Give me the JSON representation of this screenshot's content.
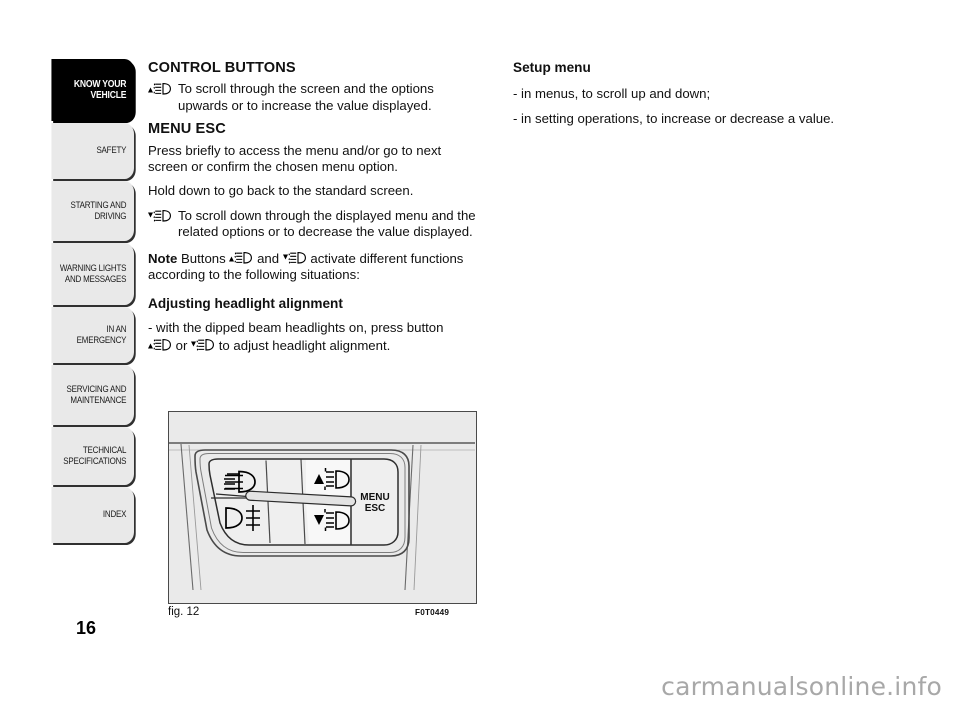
{
  "sidebar": {
    "tabs": [
      {
        "label": "KNOW YOUR\nVEHICLE",
        "active": true,
        "height": 62
      },
      {
        "label": "SAFETY",
        "active": false,
        "height": 56
      },
      {
        "label": "STARTING AND\nDRIVING",
        "active": false,
        "height": 60
      },
      {
        "label": "WARNING LIGHTS\nAND MESSAGES",
        "active": false,
        "height": 62
      },
      {
        "label": "IN AN EMERGENCY",
        "active": false,
        "height": 56
      },
      {
        "label": "SERVICING AND\nMAINTENANCE",
        "active": false,
        "height": 60
      },
      {
        "label": "TECHNICAL\nSPECIFICATIONS",
        "active": false,
        "height": 58
      },
      {
        "label": "INDEX",
        "active": false,
        "height": 56
      }
    ],
    "page_number": "16"
  },
  "left_column": {
    "heading": "CONTROL BUTTONS",
    "scroll_up_text": "To scroll through the screen and the options upwards or to increase the value displayed.",
    "menu_esc_heading": "MENU ESC",
    "menu_esc_p1": "Press briefly to access the menu and/or go to next screen or confirm the chosen menu option.",
    "menu_esc_p2": "Hold down to go back to the standard screen.",
    "scroll_down_text": "To scroll down through the displayed menu and the related options or to decrease the value displayed.",
    "note_label": "Note",
    "note_part1": "Buttons",
    "note_and": "and",
    "note_part2": "activate different functions according to the following situations:",
    "adjust_heading": "Adjusting headlight alignment",
    "adjust_line1": "- with the dipped beam headlights on, press button",
    "adjust_or": "or",
    "adjust_line2": "to adjust headlight alignment."
  },
  "right_column": {
    "heading": "Setup menu",
    "item1": "- in menus, to scroll up and down;",
    "item2": "- in setting operations, to increase or decrease a value."
  },
  "figure": {
    "caption": "fig. 12",
    "code": "F0T0449",
    "menu_label_line1": "MENU",
    "menu_label_line2": "ESC"
  },
  "watermark": "carmanualsonline.info",
  "colors": {
    "tab_inactive_bg": "#e9e9e9",
    "tab_active_bg": "#000000",
    "figure_bg": "#eaeaea",
    "figure_border": "#4a4a4a",
    "watermark": "#a8a8a8"
  }
}
